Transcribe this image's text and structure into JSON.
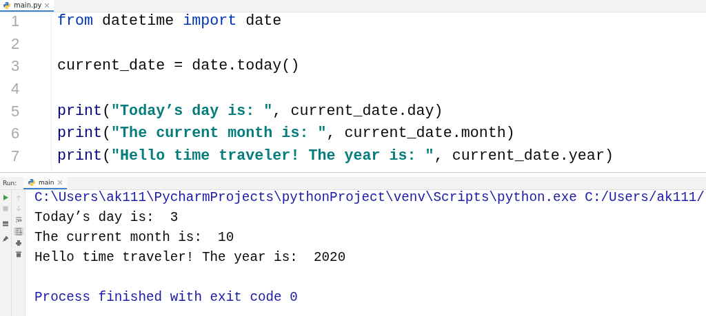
{
  "editor_tabs": [
    {
      "label": "main.py",
      "selected": true
    }
  ],
  "code_lines": [
    {
      "number": "1",
      "tokens": [
        {
          "kind": "keyword",
          "text": "from"
        },
        {
          "kind": "plain",
          "text": " datetime "
        },
        {
          "kind": "keyword",
          "text": "import"
        },
        {
          "kind": "plain",
          "text": " date"
        }
      ]
    },
    {
      "number": "2"
    },
    {
      "number": "3",
      "tokens": [
        {
          "kind": "plain",
          "text": "current_date = date.today()"
        }
      ]
    },
    {
      "number": "4"
    },
    {
      "number": "5",
      "tokens": [
        {
          "kind": "builtin",
          "text": "print"
        },
        {
          "kind": "plain",
          "text": "("
        },
        {
          "kind": "string",
          "text": "\"Today’s day is: \""
        },
        {
          "kind": "plain",
          "text": ", current_date.day)"
        }
      ]
    },
    {
      "number": "6",
      "tokens": [
        {
          "kind": "builtin",
          "text": "print"
        },
        {
          "kind": "plain",
          "text": "("
        },
        {
          "kind": "string",
          "text": "\"The current month is: \""
        },
        {
          "kind": "plain",
          "text": ", current_date.month)"
        }
      ]
    },
    {
      "number": "7",
      "tokens": [
        {
          "kind": "builtin",
          "text": "print"
        },
        {
          "kind": "plain",
          "text": "("
        },
        {
          "kind": "string",
          "text": "\"Hello time traveler! The year is: \""
        },
        {
          "kind": "plain",
          "text": ", current_date.year)"
        }
      ]
    }
  ],
  "run_panel": {
    "label": "Run:",
    "tabs": [
      {
        "label": "main",
        "selected": true
      }
    ],
    "console": [
      {
        "kind": "system",
        "text": "C:\\Users\\ak111\\PycharmProjects\\pythonProject\\venv\\Scripts\\python.exe C:/Users/ak111/"
      },
      {
        "kind": "output",
        "text": "Today’s day is:  3"
      },
      {
        "kind": "output",
        "text": "The current month is:  10"
      },
      {
        "kind": "output",
        "text": "Hello time traveler! The year is:  2020"
      },
      {
        "kind": "exit",
        "text": "Process finished with exit code 0"
      }
    ]
  }
}
